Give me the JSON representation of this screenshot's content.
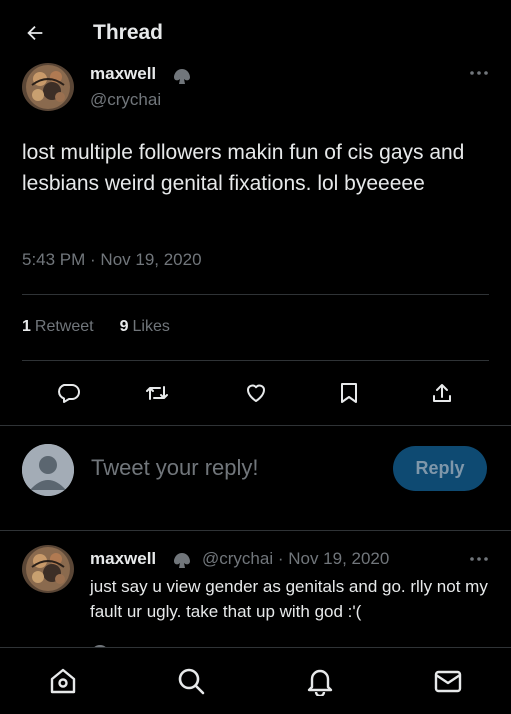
{
  "header": {
    "title": "Thread"
  },
  "tweet": {
    "author_name": "maxwell",
    "author_handle": "@crychai",
    "text": "lost multiple followers makin fun of cis gays and lesbians weird genital fixations. lol byeeeee",
    "timestamp": "5:43 PM · Nov 19, 2020",
    "retweet_count": "1",
    "retweet_label": "Retweet",
    "like_count": "9",
    "like_label": "Likes"
  },
  "reply_box": {
    "placeholder": "Tweet your reply!",
    "button_label": "Reply"
  },
  "reply": {
    "author_name": "maxwell",
    "meta": "@crychai · Nov 19, 2020",
    "text": "just say u view gender as genitals and go. rlly not my fault ur ugly. take that up with god :'("
  },
  "colors": {
    "background": "#000000",
    "text_primary": "#e7e9ea",
    "text_secondary": "#71767b",
    "divider": "#2f3336",
    "reply_button": "#0e4a72"
  },
  "icons": {
    "back": "arrow-left-icon",
    "more": "more-horizontal-icon",
    "locked": "lock-icon",
    "reply": "comment-icon",
    "retweet": "retweet-icon",
    "like": "heart-icon",
    "bookmark": "bookmark-icon",
    "share": "share-icon",
    "nav": [
      "home-icon",
      "search-icon",
      "notifications-icon",
      "messages-icon"
    ]
  }
}
